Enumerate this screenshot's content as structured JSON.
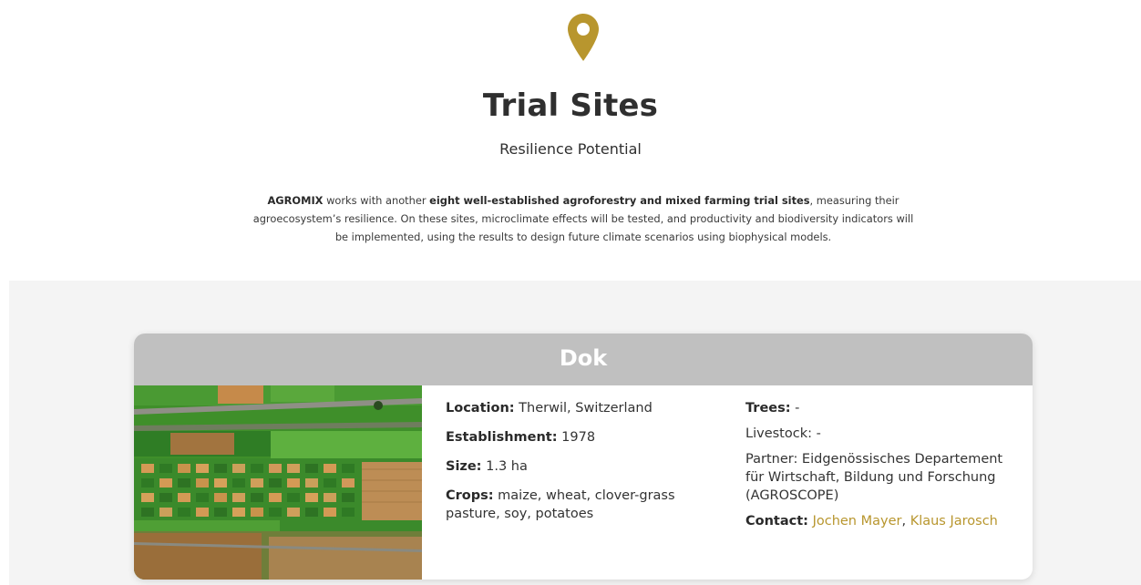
{
  "header": {
    "icon": "map-pin-icon",
    "title": "Trial Sites",
    "subtitle": "Resilience Potential"
  },
  "intro": {
    "brand": "AGROMIX",
    "text1": " works with another ",
    "highlight": "eight well-established agroforestry and mixed farming trial sites",
    "text2": ", measuring their agroecosystem’s resilience. On these sites, microclimate effects will be tested, and productivity and biodiversity indicators will be implemented, using the results to design future climate scenarios using biophysical models."
  },
  "site": {
    "name": "Dok",
    "image": "aerial-field-plots-image",
    "location_label": "Location:",
    "location": " Therwil, Switzerland",
    "establishment_label": "Establishment:",
    "establishment": " 1978",
    "size_label": "Size:",
    "size": " 1.3 ha",
    "crops_label": "Crops:",
    "crops": " maize, wheat, clover-grass pasture, soy, potatoes",
    "trees_label": "Trees:",
    "trees": " -",
    "livestock": "Livestock: -",
    "partner": "Partner: Eidgenössisches Departement für Wirtschaft, Bildung und Forschung (AGROSCOPE)",
    "contact_label": "Contact:",
    "contact1": "Jochen Mayer",
    "contact_sep": ", ",
    "contact2": "Klaus Jarosch"
  },
  "colors": {
    "accent": "#b8962e",
    "header_gray": "#c0c0c0",
    "band": "#f4f4f4"
  }
}
